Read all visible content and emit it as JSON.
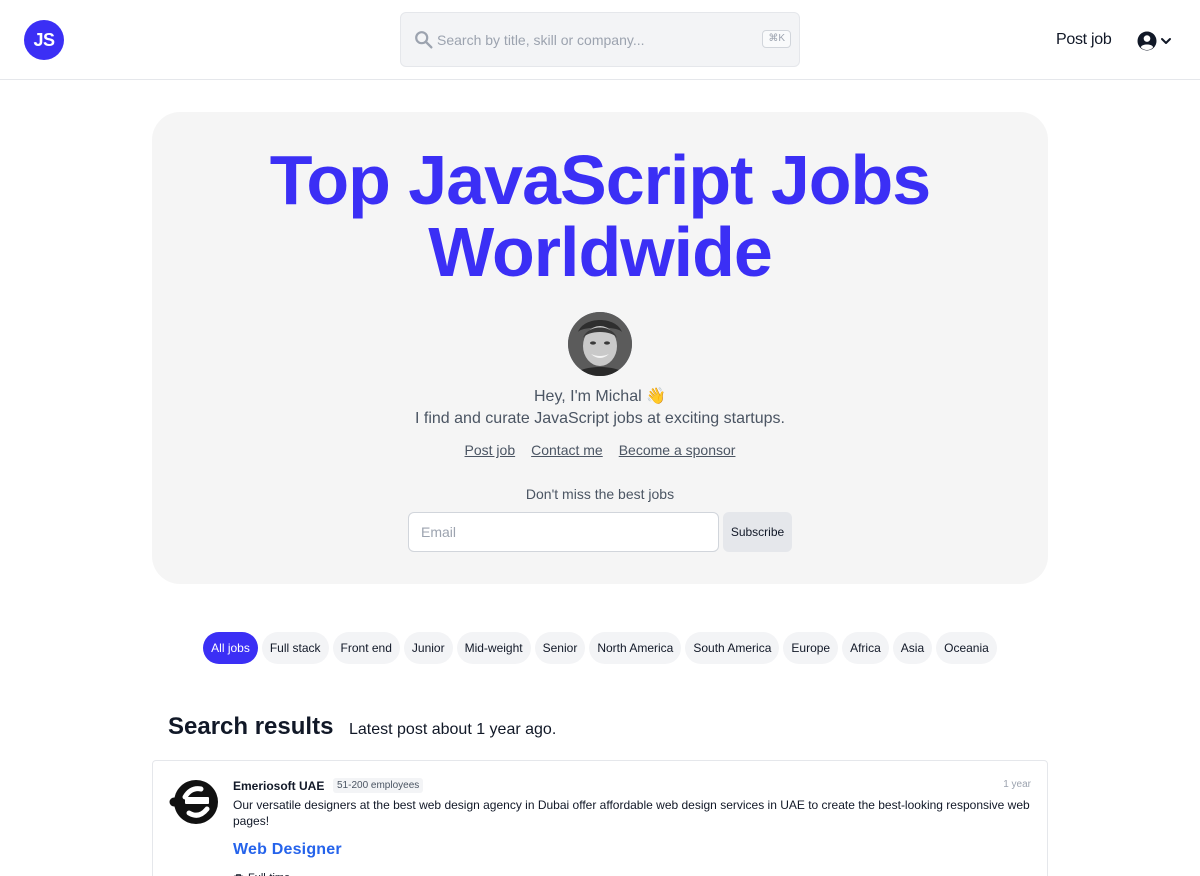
{
  "header": {
    "logo_text": "JS",
    "search_placeholder": "Search by title, skill or company...",
    "search_shortcut": "⌘K",
    "post_job_label": "Post job",
    "user_icon": "user-circle-icon",
    "accent_color": "#3b2ff5"
  },
  "hero": {
    "title": "Top JavaScript Jobs Worldwide",
    "greeting": "Hey, I'm Michal 👋",
    "tagline": "I find and curate JavaScript jobs at exciting startups.",
    "links": [
      "Post job",
      "Contact me",
      "Become a sponsor"
    ],
    "newsletter_label": "Don't miss the best jobs",
    "email_placeholder": "Email",
    "subscribe_label": "Subscribe"
  },
  "filters": [
    {
      "label": "All jobs",
      "active": true
    },
    {
      "label": "Full stack",
      "active": false
    },
    {
      "label": "Front end",
      "active": false
    },
    {
      "label": "Junior",
      "active": false
    },
    {
      "label": "Mid-weight",
      "active": false
    },
    {
      "label": "Senior",
      "active": false
    },
    {
      "label": "North America",
      "active": false
    },
    {
      "label": "South America",
      "active": false
    },
    {
      "label": "Europe",
      "active": false
    },
    {
      "label": "Africa",
      "active": false
    },
    {
      "label": "Asia",
      "active": false
    },
    {
      "label": "Oceania",
      "active": false
    }
  ],
  "results": {
    "title": "Search results",
    "subtitle": "Latest post about 1 year ago."
  },
  "jobs": [
    {
      "company": "Emeriosoft UAE",
      "size": "51-200 employees",
      "posted": "1 year",
      "description": "Our versatile designers at the best web design agency in Dubai offer affordable web design services in UAE to create the best-looking responsive web pages!",
      "title": "Web Designer",
      "type": "Full-time",
      "type_icon": "briefcase-icon"
    }
  ]
}
